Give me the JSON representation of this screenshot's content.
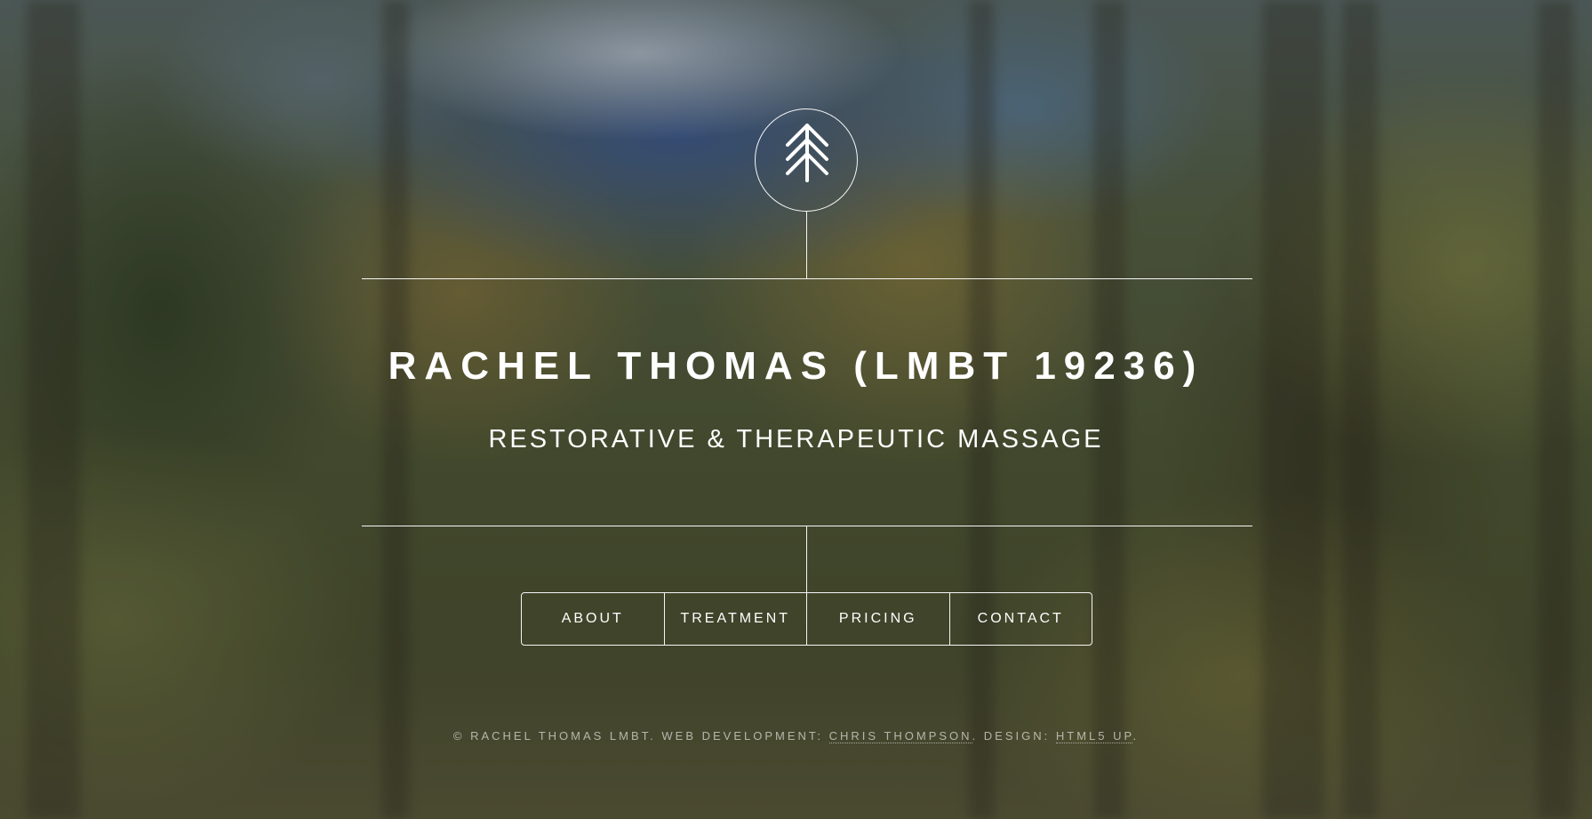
{
  "header": {
    "logo_icon": "tree-icon",
    "title": "RACHEL THOMAS (LMBT 19236)",
    "subtitle": "RESTORATIVE & THERAPEUTIC MASSAGE"
  },
  "nav": {
    "items": [
      {
        "label": "ABOUT"
      },
      {
        "label": "TREATMENT"
      },
      {
        "label": "PRICING"
      },
      {
        "label": "CONTACT"
      }
    ]
  },
  "footer": {
    "copyright": "© RACHEL THOMAS LMBT. WEB DEVELOPMENT: ",
    "dev_link": "CHRIS THOMPSON",
    "separator": ". DESIGN: ",
    "design_link": "HTML5 UP",
    "end": "."
  },
  "colors": {
    "text": "#ffffff",
    "lines": "#ffffff",
    "footer_text": "rgba(255,255,255,0.6)"
  }
}
